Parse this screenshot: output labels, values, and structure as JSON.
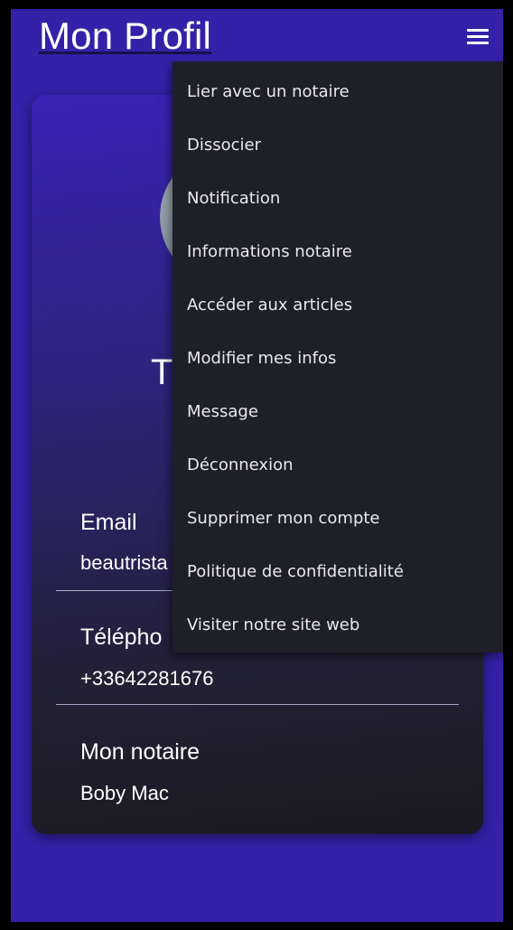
{
  "header": {
    "title": "Mon Profil",
    "menu_icon": "hamburger-menu-icon"
  },
  "profile": {
    "name": "T",
    "avatar_icon": "avatar-image"
  },
  "fields": {
    "email": {
      "label": "Email",
      "value": "beautrista"
    },
    "phone": {
      "label": "Télépho",
      "value": "+33642281676"
    },
    "notary": {
      "label": "Mon notaire",
      "value": "Boby Mac"
    }
  },
  "menu": {
    "items": [
      {
        "label": "Lier avec un notaire"
      },
      {
        "label": "Dissocier"
      },
      {
        "label": "Notification"
      },
      {
        "label": "Informations notaire"
      },
      {
        "label": "Accéder aux articles"
      },
      {
        "label": "Modifier mes infos"
      },
      {
        "label": "Message"
      },
      {
        "label": "Déconnexion"
      },
      {
        "label": "Supprimer mon compte"
      },
      {
        "label": "Politique de confidentialité"
      },
      {
        "label": "Visiter notre site web"
      }
    ]
  },
  "colors": {
    "background": "#3421a8",
    "menu_background": "#1f1f29",
    "text": "#ffffff"
  }
}
